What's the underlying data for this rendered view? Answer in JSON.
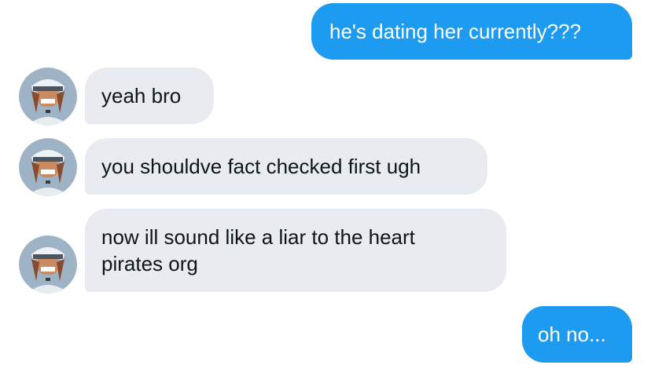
{
  "conversation": {
    "messages": [
      {
        "direction": "sent",
        "text": "he's dating her currently???"
      },
      {
        "direction": "received",
        "text": "yeah bro",
        "avatar": "profile-avatar"
      },
      {
        "direction": "received",
        "text": "you shouldve fact checked first ugh",
        "avatar": "profile-avatar"
      },
      {
        "direction": "received",
        "lines": [
          "now ill sound like a liar to the heart",
          "pirates org"
        ],
        "avatar": "profile-avatar"
      },
      {
        "direction": "sent",
        "text": "oh no..."
      }
    ]
  },
  "colors": {
    "sent_bubble": "#1d9bf0",
    "sent_text": "#ffffff",
    "received_bubble": "#e8ecf0",
    "received_text": "#0f1419",
    "background": "#ffffff"
  }
}
